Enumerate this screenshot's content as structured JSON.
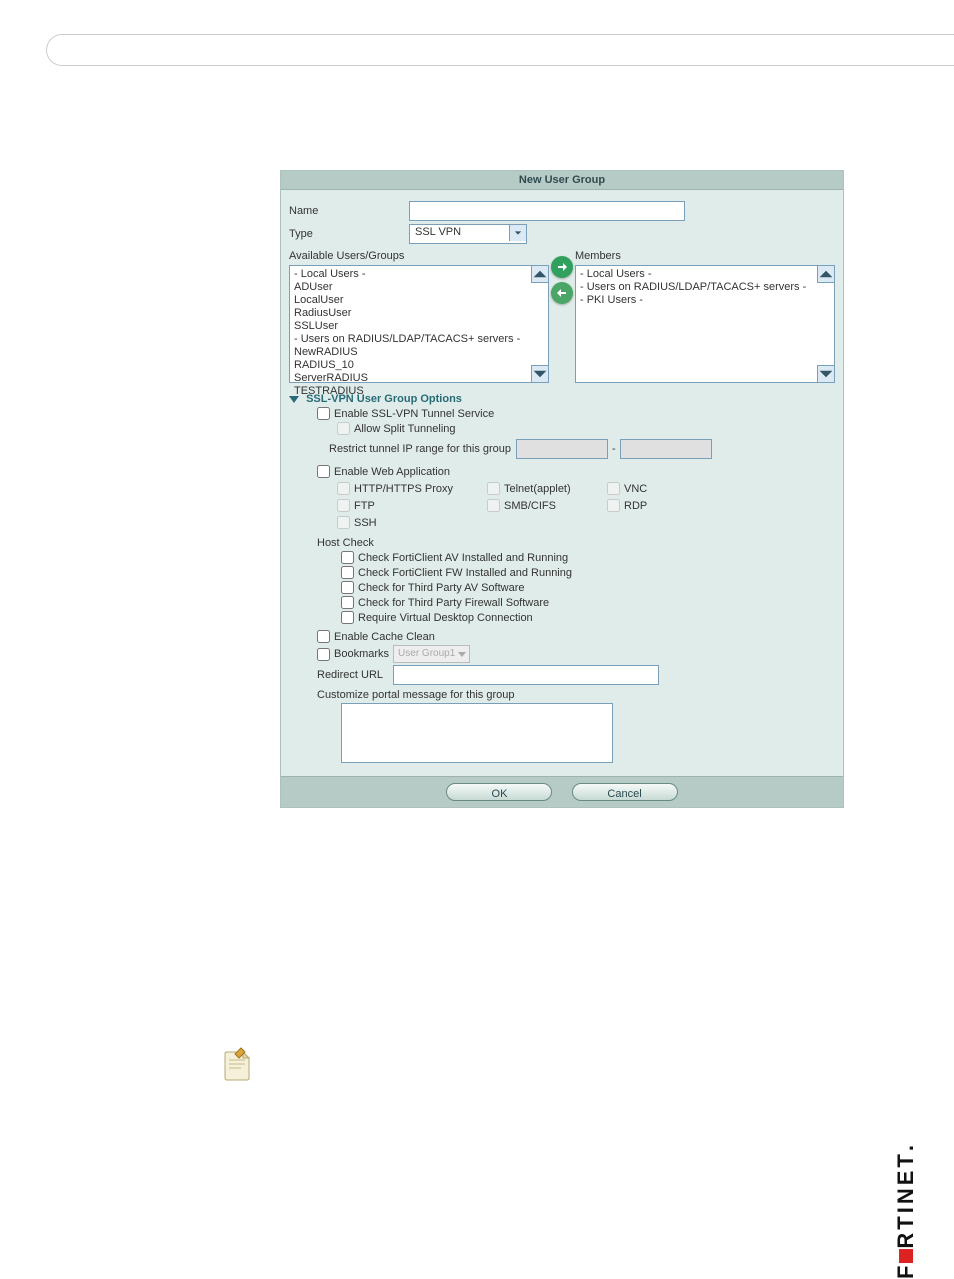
{
  "header": {
    "title": "New User Group"
  },
  "fields": {
    "name_label": "Name",
    "name_value": "",
    "type_label": "Type",
    "type_value": "SSL VPN"
  },
  "dual": {
    "available_label": "Available Users/Groups",
    "members_label": "Members",
    "available": [
      "- Local Users -",
      "ADUser",
      "LocalUser",
      "RadiusUser",
      "SSLUser",
      "- Users on RADIUS/LDAP/TACACS+ servers -",
      "NewRADIUS",
      "RADIUS_10",
      "ServerRADIUS",
      "TESTRADIUS"
    ],
    "members": [
      "- Local Users -",
      "- Users on RADIUS/LDAP/TACACS+ servers -",
      "- PKI Users -"
    ]
  },
  "sslopts": {
    "header": "SSL-VPN User Group Options",
    "enable_tunnel": "Enable SSL-VPN Tunnel Service",
    "allow_split": "Allow Split Tunneling",
    "restrict_label": "Restrict tunnel IP range for this group",
    "ip_from": "",
    "ip_to": "",
    "enable_web": "Enable Web Application",
    "webapps": {
      "http": "HTTP/HTTPS Proxy",
      "telnet": "Telnet(applet)",
      "vnc": "VNC",
      "ftp": "FTP",
      "smb": "SMB/CIFS",
      "rdp": "RDP",
      "ssh": "SSH"
    },
    "hostcheck_label": "Host Check",
    "hc_av": "Check FortiClient AV Installed and Running",
    "hc_fw": "Check FortiClient FW Installed and Running",
    "hc_tp_av": "Check for Third Party AV Software",
    "hc_tp_fw": "Check for Third Party Firewall Software",
    "hc_vd": "Require Virtual Desktop Connection",
    "cache_clean": "Enable Cache Clean",
    "bookmarks_label": "Bookmarks",
    "bookmarks_value": "User Group1",
    "redirect_label": "Redirect URL",
    "redirect_value": "",
    "portal_msg_label": "Customize portal message for this group",
    "portal_msg_value": ""
  },
  "buttons": {
    "ok": "OK",
    "cancel": "Cancel"
  },
  "brand": "F RTINET"
}
